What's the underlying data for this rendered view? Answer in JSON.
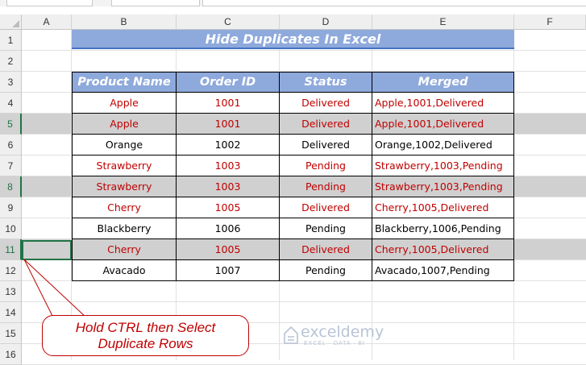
{
  "columns": [
    "A",
    "B",
    "C",
    "D",
    "E",
    "F"
  ],
  "rows": [
    "1",
    "2",
    "3",
    "4",
    "5",
    "6",
    "7",
    "8",
    "9",
    "10",
    "11",
    "12",
    "13",
    "14",
    "15",
    "16"
  ],
  "selected_rows": [
    "5",
    "8",
    "11"
  ],
  "title": "Hide Duplicates In Excel",
  "table": {
    "headers": [
      "Product Name",
      "Order ID",
      "Status",
      "Merged"
    ],
    "rows": [
      {
        "product": "Apple",
        "order": "1001",
        "status": "Delivered",
        "merged": "Apple,1001,Delivered",
        "dup": true,
        "sel": false
      },
      {
        "product": "Apple",
        "order": "1001",
        "status": "Delivered",
        "merged": "Apple,1001,Delivered",
        "dup": true,
        "sel": true
      },
      {
        "product": "Orange",
        "order": "1002",
        "status": "Delivered",
        "merged": "Orange,1002,Delivered",
        "dup": false,
        "sel": false
      },
      {
        "product": "Strawberry",
        "order": "1003",
        "status": "Pending",
        "merged": "Strawberry,1003,Pending",
        "dup": true,
        "sel": false
      },
      {
        "product": "Strawberry",
        "order": "1003",
        "status": "Pending",
        "merged": "Strawberry,1003,Pending",
        "dup": true,
        "sel": true
      },
      {
        "product": "Cherry",
        "order": "1005",
        "status": "Delivered",
        "merged": "Cherry,1005,Delivered",
        "dup": true,
        "sel": false
      },
      {
        "product": "Blackberry",
        "order": "1006",
        "status": "Pending",
        "merged": "Blackberry,1006,Pending",
        "dup": false,
        "sel": false
      },
      {
        "product": "Cherry",
        "order": "1005",
        "status": "Delivered",
        "merged": "Cherry,1005,Delivered",
        "dup": true,
        "sel": true
      },
      {
        "product": "Avacado",
        "order": "1007",
        "status": "Pending",
        "merged": "Avacado,1007,Pending",
        "dup": false,
        "sel": false
      }
    ]
  },
  "callout": {
    "line1": "Hold CTRL then Select",
    "line2": "Duplicate Rows"
  },
  "logo": {
    "name": "exceldemy",
    "tagline": "EXCEL · DATA · BI"
  },
  "colors": {
    "header_fill": "#8ea9db",
    "duplicate_text": "#c00000",
    "selection_band": "#d0d0d0",
    "accent": "#217346"
  }
}
